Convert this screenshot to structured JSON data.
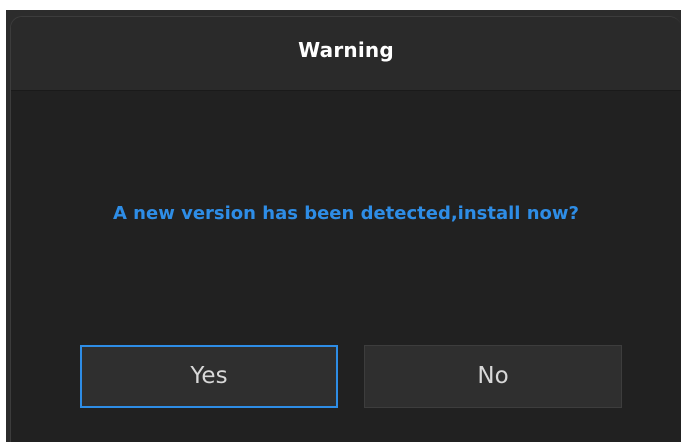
{
  "dialog": {
    "title": "Warning",
    "message": "A new version has been detected,install now?",
    "buttons": {
      "yes_label": "Yes",
      "no_label": "No"
    }
  },
  "colors": {
    "accent": "#2e8de6",
    "dialog_background": "#212121",
    "title_text": "#ffffff",
    "button_text": "#d8d8d8"
  }
}
